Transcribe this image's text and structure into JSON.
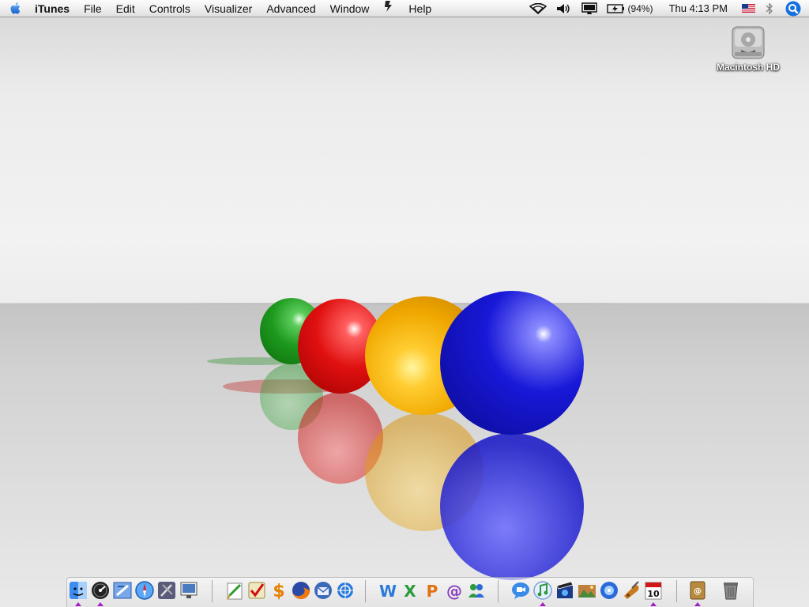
{
  "menubar": {
    "apple_icon": "apple-logo-icon",
    "app_name": "iTunes",
    "menus": [
      "File",
      "Edit",
      "Controls",
      "Visualizer",
      "Advanced",
      "Window",
      "Help"
    ],
    "script_menu_icon": "script-menu-icon",
    "status": {
      "wifi_icon": "wifi-icon",
      "volume_icon": "volume-icon",
      "display_icon": "display-mirroring-icon",
      "battery_icon": "battery-charging-icon",
      "battery_percent": "(94%)",
      "clock": "Thu 4:13 PM",
      "input_menu_icon": "us-flag-icon",
      "bluetooth_icon": "bluetooth-icon",
      "spotlight_icon": "spotlight-icon"
    }
  },
  "desktop": {
    "icons": [
      {
        "label": "Macintosh HD",
        "icon": "hard-drive-icon"
      }
    ],
    "wallpaper": {
      "sphere_colors": [
        "#1e9a1e",
        "#e01010",
        "#f0a800",
        "#1818d8"
      ]
    }
  },
  "dock": {
    "accent_running": "#a020c0",
    "items": [
      {
        "icon": "finder-icon",
        "running": true
      },
      {
        "icon": "dashboard-icon",
        "running": true
      },
      {
        "icon": "mail-icon",
        "running": false
      },
      {
        "icon": "safari-icon",
        "running": false
      },
      {
        "icon": "system-preferences-icon",
        "running": false
      },
      {
        "icon": "preview-icon",
        "running": false
      },
      {
        "icon": "textedit-icon",
        "running": false
      },
      {
        "icon": "tasks-icon",
        "running": false
      },
      {
        "icon": "money-icon",
        "running": false
      },
      {
        "icon": "firefox-icon",
        "running": false
      },
      {
        "icon": "thunderbird-icon",
        "running": false
      },
      {
        "icon": "network-utility-icon",
        "running": false
      },
      {
        "icon": "office-word-icon",
        "running": false
      },
      {
        "icon": "office-excel-icon",
        "running": false
      },
      {
        "icon": "office-powerpoint-icon",
        "running": false
      },
      {
        "icon": "office-entourage-icon",
        "running": false
      },
      {
        "icon": "messenger-icon",
        "running": false
      },
      {
        "icon": "ichat-icon",
        "running": false
      },
      {
        "icon": "itunes-icon",
        "running": true
      },
      {
        "icon": "imovie-icon",
        "running": false
      },
      {
        "icon": "iphoto-icon",
        "running": false
      },
      {
        "icon": "idvd-icon",
        "running": false
      },
      {
        "icon": "garageband-icon",
        "running": false
      },
      {
        "icon": "ical-icon",
        "running": true,
        "date": "10"
      },
      {
        "icon": "address-book-icon",
        "running": true
      },
      {
        "icon": "trash-icon",
        "running": false
      }
    ]
  }
}
